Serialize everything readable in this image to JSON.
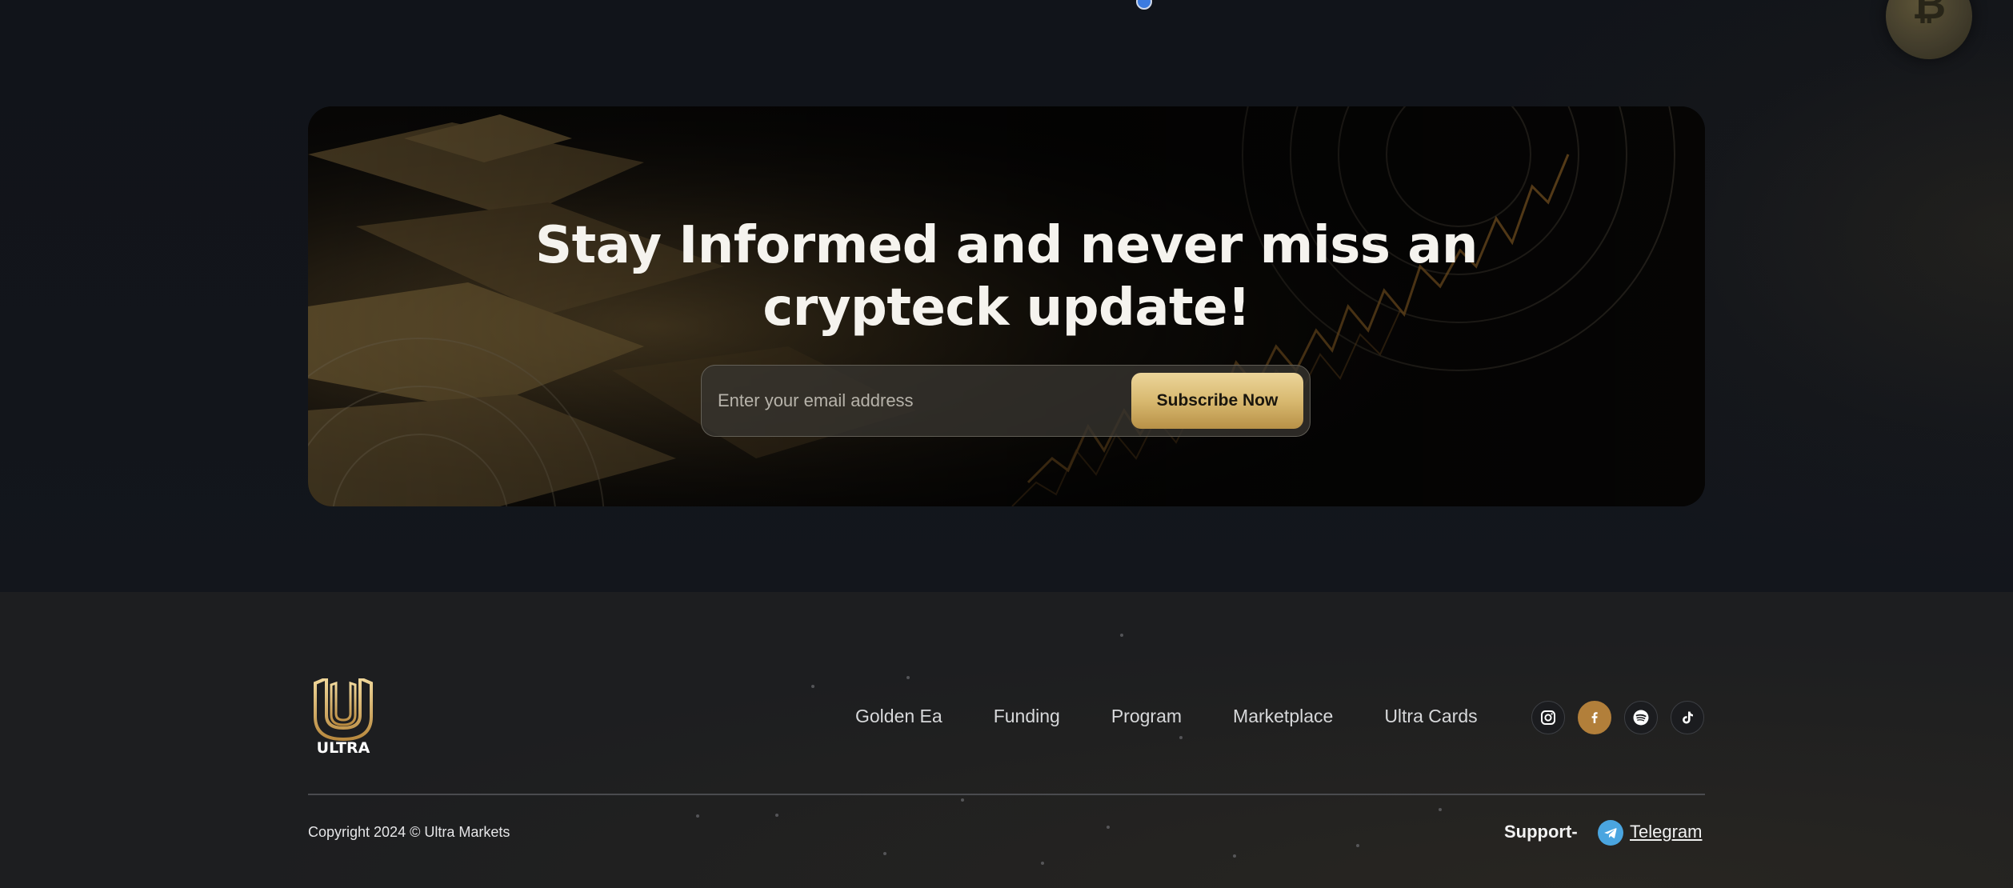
{
  "newsletter": {
    "title": "Stay Informed and never miss an\ncrypteck update!",
    "email_placeholder": "Enter your email address",
    "subscribe_label": "Subscribe Now"
  },
  "footer": {
    "logo_text": "ULTRA",
    "nav": [
      "Golden Ea",
      "Funding",
      "Program",
      "Marketplace",
      "Ultra Cards"
    ],
    "social": [
      {
        "name": "instagram-icon",
        "active": false
      },
      {
        "name": "facebook-icon",
        "active": true
      },
      {
        "name": "spotify-icon",
        "active": false
      },
      {
        "name": "tiktok-icon",
        "active": false
      }
    ],
    "copyright": "Copyright 2024 © Ultra Markets",
    "support_label": "Support-",
    "telegram_label": "Telegram"
  },
  "colors": {
    "page_background": "#12151b",
    "footer_background": "#1d1e20",
    "gold_accent": "#d8b970",
    "social_active": "#b27f3a",
    "telegram_blue": "#4aa5e0"
  },
  "decorations": {
    "coin_symbol": "₿"
  }
}
